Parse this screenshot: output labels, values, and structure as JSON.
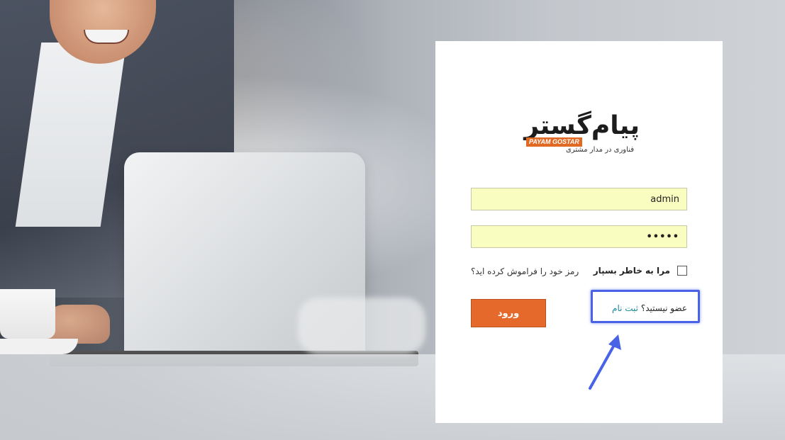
{
  "logo": {
    "brand_fa": "پیام‌گستر",
    "brand_en": "PAYAM GOSTAR",
    "tagline": "فناوری در مدار مشتری"
  },
  "login_form": {
    "username_value": "admin",
    "password_value": "•••••",
    "remember_label": "مرا به خاطر بسپار",
    "forgot_link": "رمز خود را فراموش کرده اید؟",
    "login_button": "ورود",
    "signup_question": "عضو نیستید؟",
    "signup_link": "ثبت نام"
  },
  "colors": {
    "accent_orange": "#e4692a",
    "input_background": "#fafdc0",
    "highlight_blue": "#4a63e6",
    "link_teal": "#1a8a9a"
  }
}
